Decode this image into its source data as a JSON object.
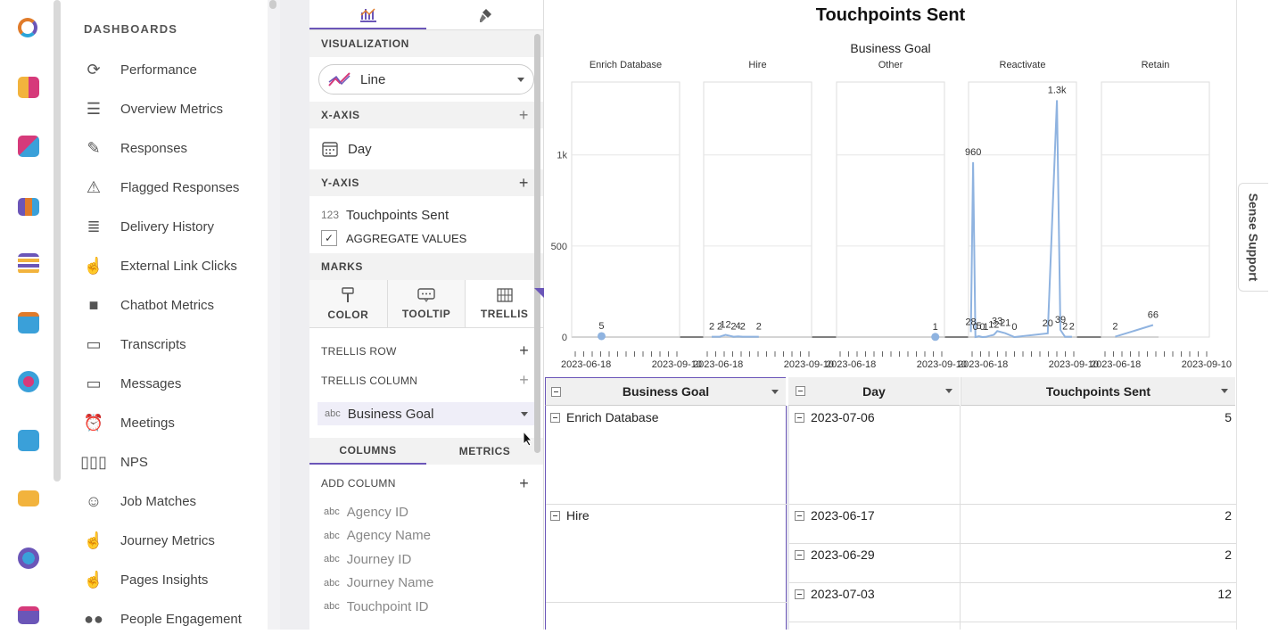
{
  "rail": {
    "icons": [
      "logo-ring-icon",
      "dashboard-grid-icon",
      "arrows-exchange-icon",
      "bar-chart-icon",
      "list-stack-icon",
      "calendar-icon",
      "people-group-icon",
      "bot-face-icon",
      "chat-bubble-icon",
      "person-gear-icon",
      "window-icon"
    ]
  },
  "nav": {
    "heading": "DASHBOARDS",
    "items": [
      {
        "label": "Performance",
        "icon": "refresh-icon"
      },
      {
        "label": "Overview Metrics",
        "icon": "stack-icon"
      },
      {
        "label": "Responses",
        "icon": "pencil-icon"
      },
      {
        "label": "Flagged Responses",
        "icon": "warning-icon"
      },
      {
        "label": "Delivery History",
        "icon": "list-icon"
      },
      {
        "label": "External Link Clicks",
        "icon": "pointer-click-icon"
      },
      {
        "label": "Chatbot Metrics",
        "icon": "folder-icon"
      },
      {
        "label": "Transcripts",
        "icon": "transcript-icon"
      },
      {
        "label": "Messages",
        "icon": "message-icon"
      },
      {
        "label": "Meetings",
        "icon": "alarm-clock-icon"
      },
      {
        "label": "NPS",
        "icon": "nps-icon"
      },
      {
        "label": "Job Matches",
        "icon": "person-icon"
      },
      {
        "label": "Journey Metrics",
        "icon": "pointer-click-icon"
      },
      {
        "label": "Pages Insights",
        "icon": "pointer-click-icon"
      },
      {
        "label": "People Engagement",
        "icon": "people-icon"
      }
    ]
  },
  "config": {
    "tabs": [
      {
        "icon": "chart-config-icon"
      },
      {
        "icon": "paint-brush-icon"
      }
    ],
    "visualization": {
      "label": "VISUALIZATION",
      "value": "Line"
    },
    "xaxis": {
      "label": "X-AXIS",
      "field": "Day"
    },
    "yaxis": {
      "label": "Y-AXIS",
      "field_type": "123",
      "field": "Touchpoints Sent",
      "aggregate": "AGGREGATE VALUES"
    },
    "marks": {
      "label": "MARKS",
      "tabs": [
        "COLOR",
        "TOOLTIP",
        "TRELLIS"
      ]
    },
    "trellis_row": "TRELLIS ROW",
    "trellis_column": "TRELLIS COLUMN",
    "trellis_field": {
      "type": "abc",
      "label": "Business Goal"
    },
    "bottom_tabs": [
      "COLUMNS",
      "METRICS"
    ],
    "add_column": "ADD COLUMN",
    "columns": [
      "Agency ID",
      "Agency Name",
      "Journey ID",
      "Journey Name",
      "Touchpoint ID"
    ],
    "col_type": "abc"
  },
  "chart_data": {
    "type": "line",
    "title": "Touchpoints Sent",
    "trellis_title": "Business Goal",
    "ylim": [
      0,
      1400
    ],
    "yticks": [
      0,
      500,
      1000
    ],
    "ytick_labels": [
      "0",
      "500",
      "1k"
    ],
    "xtick_labels": [
      "2023-06-18",
      "2023-09-10"
    ],
    "xlim": [
      "2023-06-10",
      "2023-09-12"
    ],
    "panels": [
      {
        "name": "Enrich Database",
        "points": [
          {
            "x": "2023-07-06",
            "y": 5,
            "label": "5"
          }
        ]
      },
      {
        "name": "Hire",
        "points": [
          {
            "x": "2023-06-17",
            "y": 2,
            "label": "2"
          },
          {
            "x": "2023-06-24",
            "y": 2,
            "label": "2"
          },
          {
            "x": "2023-06-29",
            "y": 12,
            "label": "12"
          },
          {
            "x": "2023-07-06",
            "y": 2,
            "label": "2"
          },
          {
            "x": "2023-07-10",
            "y": 4,
            "label": "4"
          },
          {
            "x": "2023-07-14",
            "y": 2,
            "label": "2"
          },
          {
            "x": "2023-07-28",
            "y": 2,
            "label": "2"
          }
        ]
      },
      {
        "name": "Other",
        "points": [
          {
            "x": "2023-09-04",
            "y": 1,
            "label": "1"
          }
        ]
      },
      {
        "name": "Reactivate",
        "points": [
          {
            "x": "2023-06-12",
            "y": 28,
            "label": "28"
          },
          {
            "x": "2023-06-14",
            "y": 960,
            "label": "960"
          },
          {
            "x": "2023-06-16",
            "y": 0,
            "label": "0"
          },
          {
            "x": "2023-06-19",
            "y": 5,
            "label": "5"
          },
          {
            "x": "2023-06-22",
            "y": 0,
            "label": "0"
          },
          {
            "x": "2023-06-25",
            "y": 1,
            "label": "1"
          },
          {
            "x": "2023-07-02",
            "y": 12,
            "label": "12"
          },
          {
            "x": "2023-07-05",
            "y": 33,
            "label": "33"
          },
          {
            "x": "2023-07-12",
            "y": 21,
            "label": "21"
          },
          {
            "x": "2023-07-20",
            "y": 0,
            "label": "0"
          },
          {
            "x": "2023-08-18",
            "y": 20,
            "label": "20"
          },
          {
            "x": "2023-08-26",
            "y": 1300,
            "label": "1.3k"
          },
          {
            "x": "2023-08-29",
            "y": 39,
            "label": "39"
          },
          {
            "x": "2023-09-02",
            "y": 2,
            "label": "2"
          },
          {
            "x": "2023-09-08",
            "y": 2,
            "label": "2"
          }
        ]
      },
      {
        "name": "Retain",
        "points": [
          {
            "x": "2023-06-22",
            "y": 2,
            "label": "2"
          },
          {
            "x": "2023-07-25",
            "y": 66,
            "label": "66"
          }
        ]
      }
    ]
  },
  "table": {
    "headers": [
      "Business Goal",
      "Day",
      "Touchpoints Sent"
    ],
    "groups": [
      {
        "goal": "Enrich Database",
        "rows": [
          {
            "day": "2023-07-06",
            "value": "5"
          }
        ]
      },
      {
        "goal": "Hire",
        "rows": [
          {
            "day": "2023-06-17",
            "value": "2"
          },
          {
            "day": "2023-06-29",
            "value": "2"
          },
          {
            "day": "2023-07-03",
            "value": "12"
          }
        ]
      }
    ]
  },
  "support": "Sense Support",
  "colors": {
    "accent": "#6b56b8",
    "line": "#8fb3e0"
  }
}
